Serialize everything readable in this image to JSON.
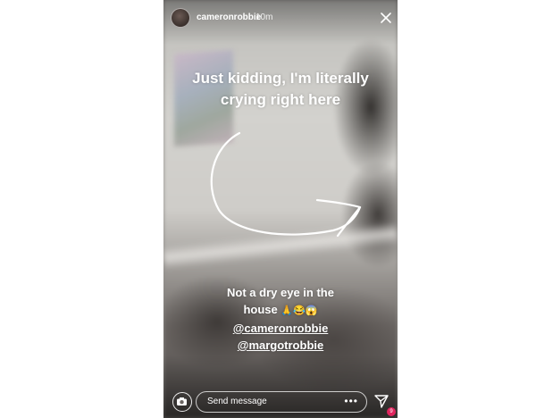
{
  "story": {
    "username": "cameronrobbie",
    "timestamp": "10m",
    "caption_top": {
      "line1": "Just kidding, I'm literally",
      "line2": "crying right here"
    },
    "caption_bottom": {
      "line1": "Not a dry eye in the",
      "line2": "house",
      "emojis": "🙏😂😱",
      "mention1": "@cameronrobbie",
      "mention2": "@margotrobbie"
    },
    "icons": {
      "close": "close-icon",
      "camera": "camera-icon",
      "more": "more-icon",
      "send": "send-icon"
    }
  },
  "footer": {
    "message_placeholder": "Send message",
    "more_label": "•••",
    "badge_count": "9"
  },
  "colors": {
    "badge": "#e0245e",
    "text": "#ffffff"
  }
}
